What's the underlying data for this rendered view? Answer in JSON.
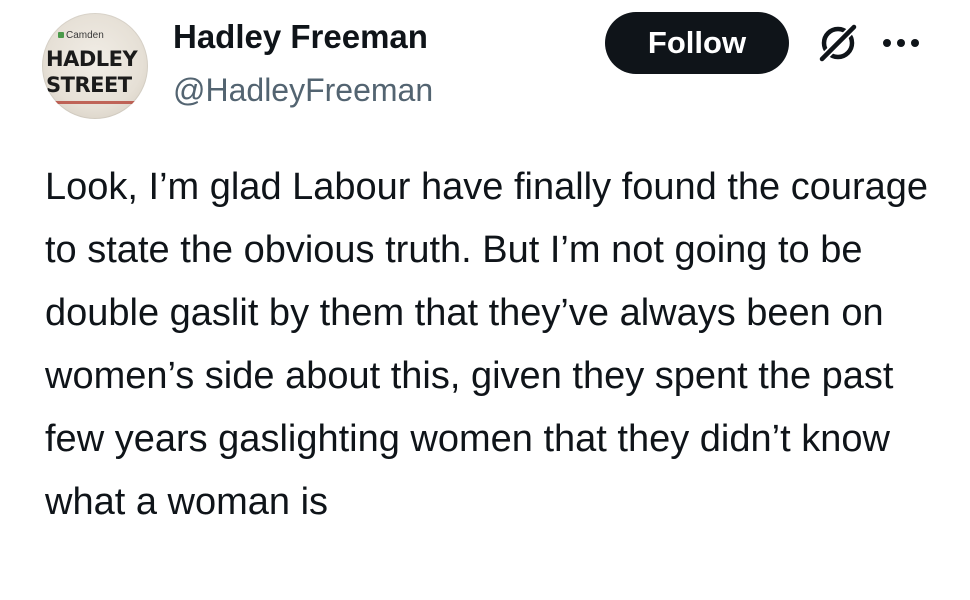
{
  "author": {
    "name": "Hadley Freeman",
    "handle": "@HadleyFreeman",
    "avatar": {
      "sign_small": "Camden",
      "sign_line1": "HADLEY",
      "sign_line2": "STREET"
    }
  },
  "actions": {
    "follow_label": "Follow",
    "grok_icon": "grok-icon",
    "more_icon": "more-options-icon"
  },
  "tweet": {
    "text": "Look, I’m glad Labour have finally found the courage to state the obvious truth. But I’m not going to be double gaslit by them that they’ve always been on women’s side about this, given they spent the past few years gaslighting women that they didn’t know what a woman is"
  },
  "colors": {
    "text_primary": "#0f1419",
    "text_secondary": "#536471",
    "button_bg": "#0f1419",
    "button_text": "#ffffff",
    "background": "#ffffff"
  }
}
